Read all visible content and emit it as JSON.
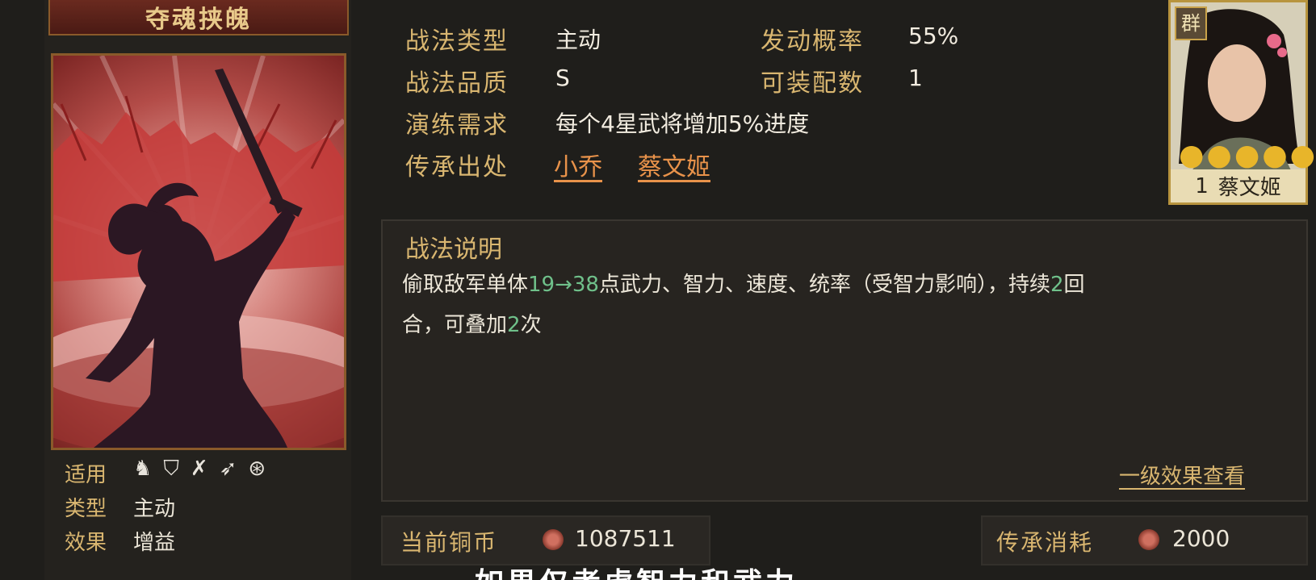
{
  "skill": {
    "name": "夺魂挟魄"
  },
  "attributes": {
    "apply_label": "适用",
    "apply_icons": [
      "cavalry-icon",
      "shield-icon",
      "crossbow-icon",
      "spear-icon",
      "wheel-icon"
    ],
    "type_label": "类型",
    "type_value": "主动",
    "effect_label": "效果",
    "effect_value": "增益"
  },
  "info": {
    "type_label": "战法类型",
    "type_value": "主动",
    "rate_label": "发动概率",
    "rate_value": "55%",
    "quality_label": "战法品质",
    "quality_value": "S",
    "slots_label": "可装配数",
    "slots_value": "1",
    "training_label": "演练需求",
    "training_value": "每个4星武将增加5%进度",
    "origin_label": "传承出处",
    "origin_values": [
      "小乔",
      "蔡文姬"
    ]
  },
  "description": {
    "title": "战法说明",
    "p1": "偷取敌军单体",
    "range": "19→38",
    "p2": "点武力、智力、速度、统率（受智力影响），持续",
    "rounds": "2",
    "p3": "回",
    "p4": "合，可叠加",
    "stacks": "2",
    "p5": "次",
    "level_link": "一级效果查看"
  },
  "costs": {
    "coin_label": "当前铜币",
    "coin_value": "1087511",
    "inherit_label": "传承消耗",
    "inherit_value": "2000"
  },
  "general": {
    "faction": "群",
    "stars": "●●●●●",
    "level": "1",
    "name": "蔡文姬"
  },
  "subtitle": "如果仅考虑智力和武力",
  "colors": {
    "gold_label": "#d9b670",
    "link_orange": "#e8924a",
    "green_number": "#6fc08a"
  }
}
